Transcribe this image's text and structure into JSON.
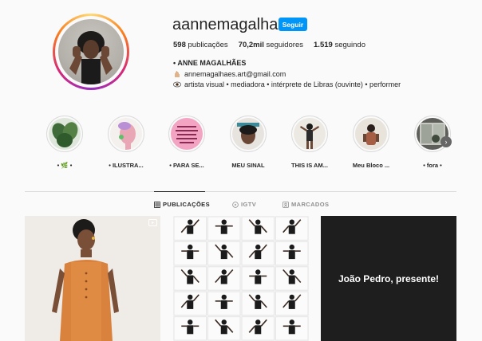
{
  "profile": {
    "username": "aannemagalhaes",
    "follow_label": "Seguir",
    "stats": {
      "posts_count": "598",
      "posts_label": "publicações",
      "followers_count": "70,2mil",
      "followers_label": "seguidores",
      "following_count": "1.519",
      "following_label": "seguindo"
    },
    "bio": {
      "name": "• ANNE MAGALHÃES",
      "email": "annemagalhaes.art@gmail.com",
      "description": "artista visual • mediadora • intérprete de Libras (ouvinte) • performer"
    }
  },
  "highlights": [
    {
      "label": "• 🌿 •",
      "icon": "plant"
    },
    {
      "label": "• ILUSTRA...",
      "icon": "illustration"
    },
    {
      "label": "• PARA SE...",
      "icon": "pink-text"
    },
    {
      "label": "MEU SINAL",
      "icon": "selfie"
    },
    {
      "label": "THIS IS AM...",
      "icon": "dancer"
    },
    {
      "label": "Meu Bloco ...",
      "icon": "portrait"
    },
    {
      "label": "• fora •",
      "icon": "window"
    }
  ],
  "tabs": [
    {
      "label": "PUBLICAÇÕES",
      "icon": "grid-icon",
      "active": true
    },
    {
      "label": "IGTV",
      "icon": "igtv-icon",
      "active": false
    },
    {
      "label": "MARCADOS",
      "icon": "tagged-icon",
      "active": false
    }
  ],
  "posts": {
    "post3_text": "João Pedro, presente!"
  },
  "colors": {
    "accent": "#0095f6",
    "text": "#262626",
    "muted": "#8e8e8e",
    "border": "#dbdbdb"
  }
}
